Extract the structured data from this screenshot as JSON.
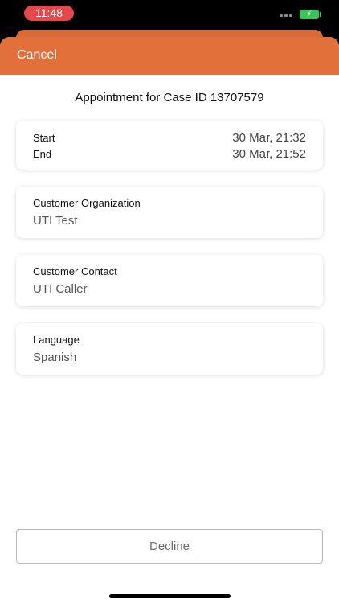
{
  "status_bar": {
    "time": "11:48",
    "time_pill_color": "#e6474a",
    "battery_color": "#39c35a",
    "battery_icon": "battery-charging-icon",
    "signal_icon": "signal-dots-icon"
  },
  "nav": {
    "cancel_label": "Cancel",
    "accent_color": "#e2703b"
  },
  "title": "Appointment for Case ID 13707579",
  "time_card": {
    "start_label": "Start",
    "start_value": "30 Mar, 21:32",
    "end_label": "End",
    "end_value": "30 Mar, 21:52"
  },
  "fields": [
    {
      "label": "Customer Organization",
      "value": "UTI Test"
    },
    {
      "label": "Customer Contact",
      "value": "UTI Caller"
    },
    {
      "label": "Language",
      "value": "Spanish"
    }
  ],
  "decline_label": "Decline"
}
